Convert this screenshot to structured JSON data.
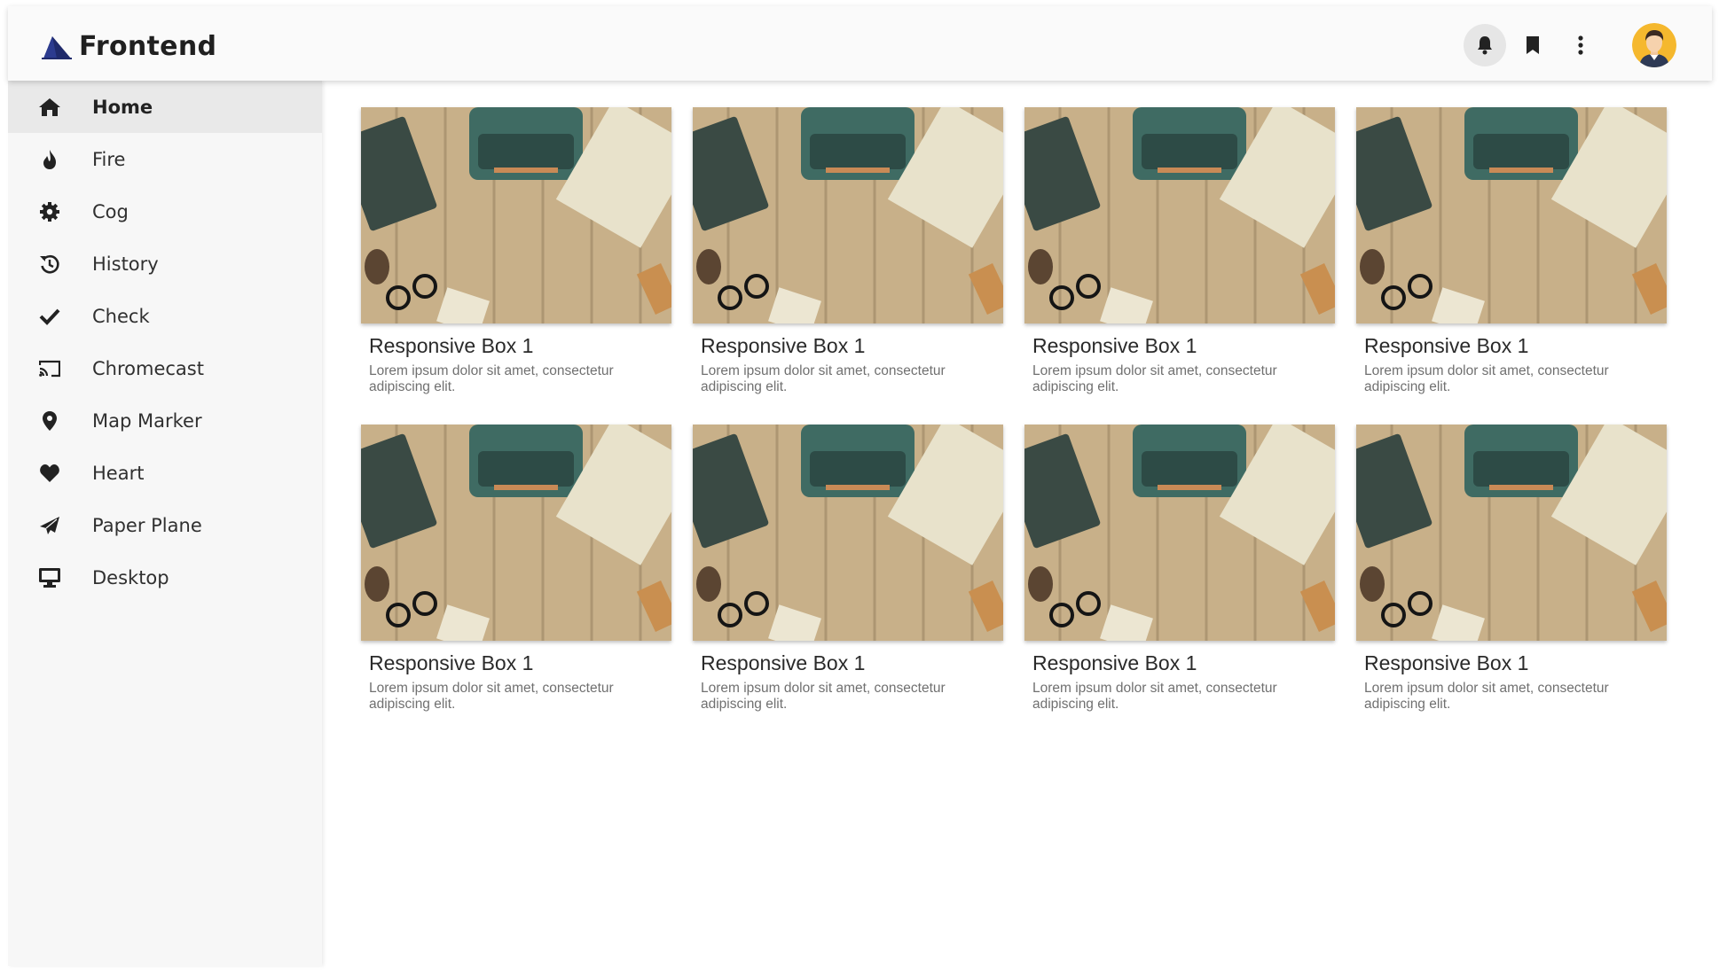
{
  "app": {
    "name": "Frontend"
  },
  "header": {
    "icons": [
      "bell-icon",
      "bookmark-icon",
      "more-vertical-icon"
    ],
    "avatar_alt": "user avatar"
  },
  "sidebar": {
    "items": [
      {
        "label": "Home",
        "icon": "home-icon",
        "active": true
      },
      {
        "label": "Fire",
        "icon": "fire-icon"
      },
      {
        "label": "Cog",
        "icon": "cog-icon"
      },
      {
        "label": "History",
        "icon": "history-icon"
      },
      {
        "label": "Check",
        "icon": "check-icon"
      },
      {
        "label": "Chromecast",
        "icon": "chromecast-icon"
      },
      {
        "label": "Map Marker",
        "icon": "map-marker-icon"
      },
      {
        "label": "Heart",
        "icon": "heart-icon"
      },
      {
        "label": "Paper Plane",
        "icon": "paper-plane-icon"
      },
      {
        "label": "Desktop",
        "icon": "desktop-icon"
      }
    ]
  },
  "cards": [
    {
      "title": "Responsive Box 1",
      "text": "Lorem ipsum dolor sit amet, consectetur adipiscing elit."
    },
    {
      "title": "Responsive Box 1",
      "text": "Lorem ipsum dolor sit amet, consectetur adipiscing elit."
    },
    {
      "title": "Responsive Box 1",
      "text": "Lorem ipsum dolor sit amet, consectetur adipiscing elit."
    },
    {
      "title": "Responsive Box 1",
      "text": "Lorem ipsum dolor sit amet, consectetur adipiscing elit."
    },
    {
      "title": "Responsive Box 1",
      "text": "Lorem ipsum dolor sit amet, consectetur adipiscing elit."
    },
    {
      "title": "Responsive Box 1",
      "text": "Lorem ipsum dolor sit amet, consectetur adipiscing elit."
    },
    {
      "title": "Responsive Box 1",
      "text": "Lorem ipsum dolor sit amet, consectetur adipiscing elit."
    },
    {
      "title": "Responsive Box 1",
      "text": "Lorem ipsum dolor sit amet, consectetur adipiscing elit."
    }
  ],
  "colors": {
    "brand": "#1f2a6b",
    "sidebar_bg": "#f7f7f7",
    "active_bg": "#e9e9e9"
  }
}
